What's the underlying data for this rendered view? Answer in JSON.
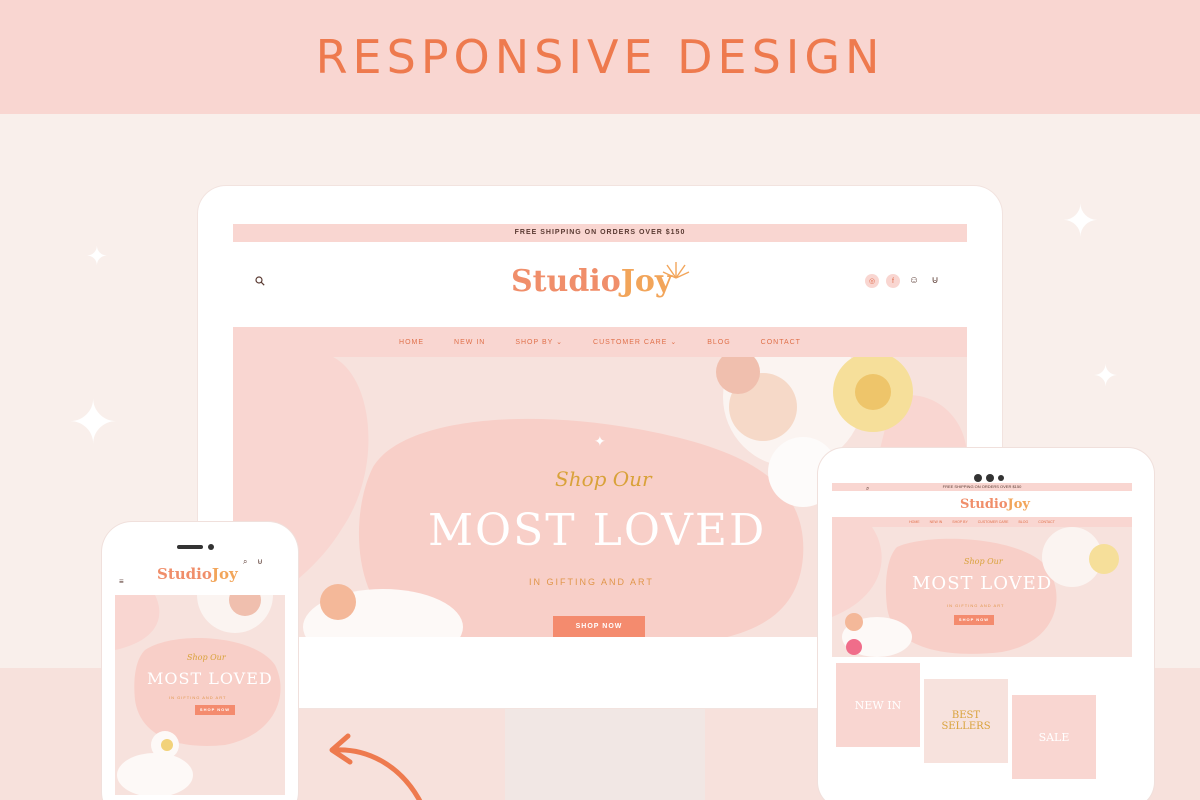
{
  "banner": {
    "title": "RESPONSIVE DESIGN"
  },
  "site": {
    "shipping_notice": "FREE SHIPPING ON ORDERS OVER $150",
    "logo": {
      "part1": "Studio",
      "part2": "Joy"
    },
    "nav": [
      "HOME",
      "NEW IN",
      "SHOP BY",
      "CUSTOMER CARE",
      "BLOG",
      "CONTACT"
    ],
    "nav_dropdown_chevron": "⌄",
    "hero": {
      "script": "Shop Our",
      "title": "MOST LOVED",
      "subtitle": "IN GIFTING AND ART",
      "cta": "SHOP NOW"
    },
    "tiles": [
      "NEW IN",
      "BEST SELLERS",
      "SALE"
    ]
  },
  "icons": [
    "search-icon",
    "instagram-icon",
    "facebook-icon",
    "account-icon",
    "cart-icon",
    "menu-icon",
    "sparkle-icon",
    "arrow-icon"
  ],
  "colors": {
    "accent": "#ee7a4e",
    "banner_bg": "#f9d6d1",
    "button": "#f48b6e",
    "gold": "#d9a23a"
  }
}
